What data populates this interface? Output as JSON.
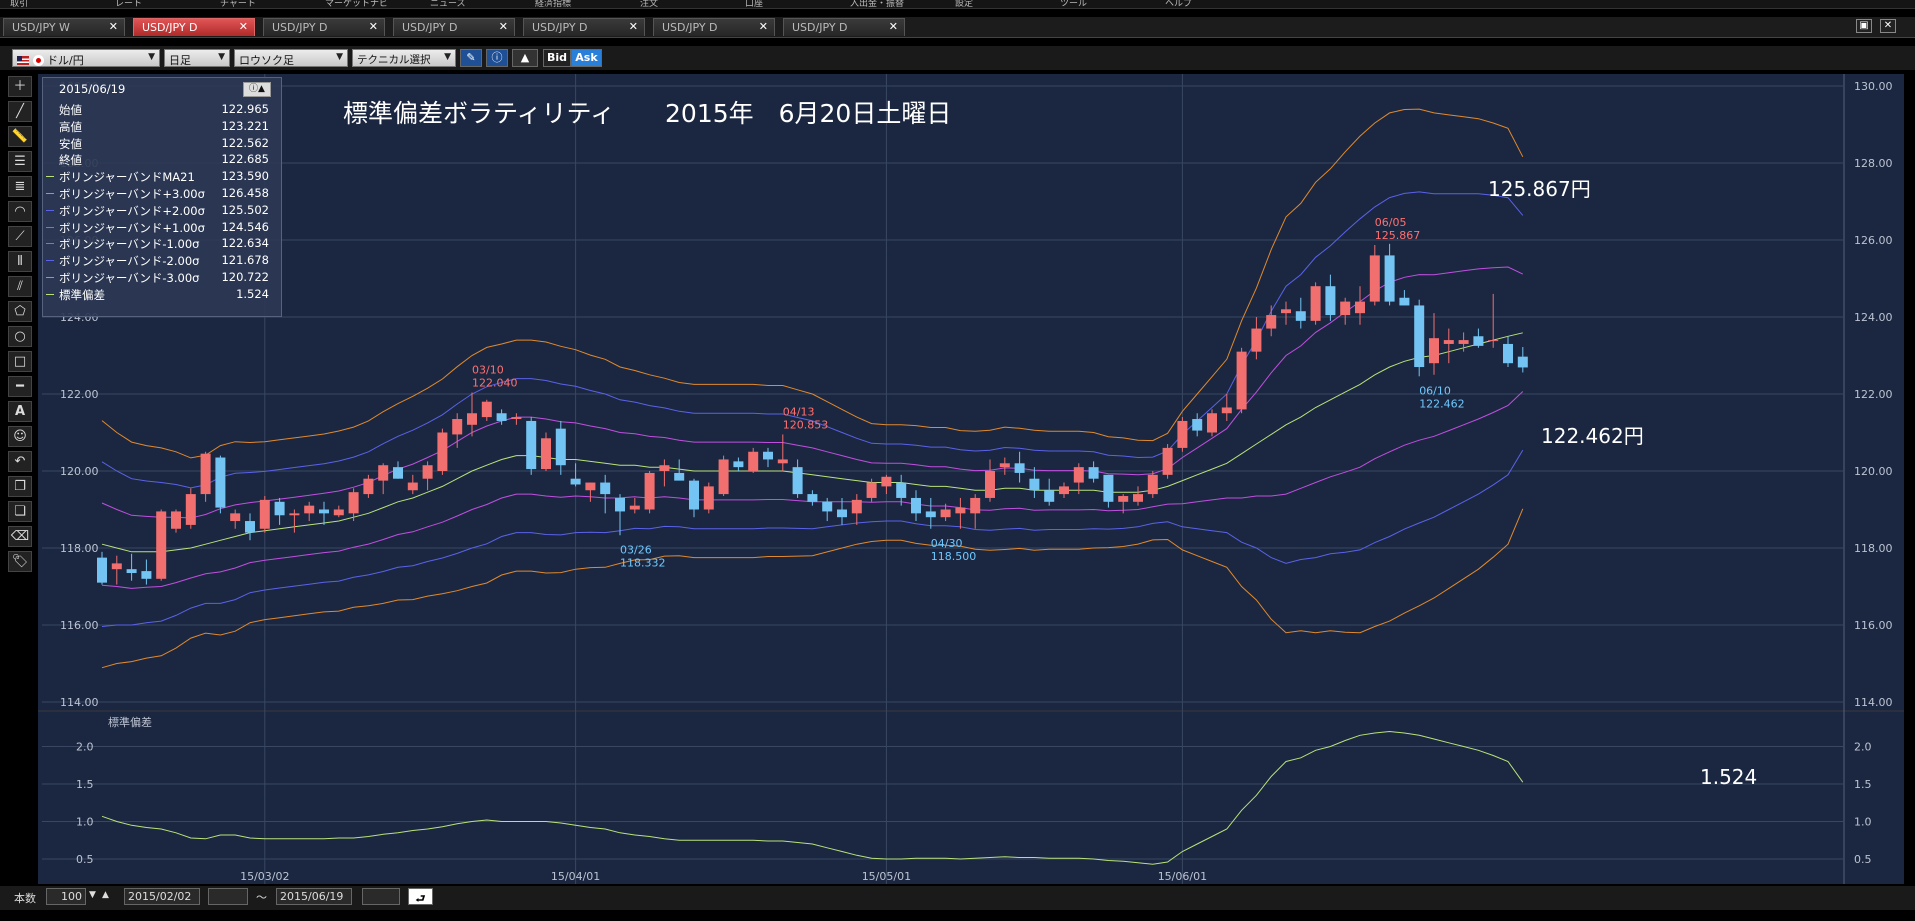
{
  "menu": [
    "取引",
    "レート",
    "チャート",
    "マーケットナビ",
    "ニュース",
    "経済指標",
    "注文",
    "口座",
    "入出金・振替",
    "設定",
    "ツール",
    "ヘルプ"
  ],
  "tabs": [
    {
      "label": "USD/JPY W",
      "active": false
    },
    {
      "label": "USD/JPY D",
      "active": true
    },
    {
      "label": "USD/JPY D",
      "active": false
    },
    {
      "label": "USD/JPY D",
      "active": false
    },
    {
      "label": "USD/JPY D",
      "active": false
    },
    {
      "label": "USD/JPY D",
      "active": false
    },
    {
      "label": "USD/JPY D",
      "active": false
    }
  ],
  "toolbar": {
    "pair": "ドル/円",
    "timeframe": "日足",
    "chart_type": "ロウソク足",
    "technical": "テクニカル選択",
    "bid": "Bid",
    "ask": "Ask"
  },
  "info": {
    "date": "2015/06/19",
    "rows": [
      {
        "label": "始値",
        "value": "122.965",
        "color": ""
      },
      {
        "label": "高値",
        "value": "123.221",
        "color": ""
      },
      {
        "label": "安値",
        "value": "122.562",
        "color": ""
      },
      {
        "label": "終値",
        "value": "122.685",
        "color": ""
      },
      {
        "label": "ボリンジャーバンドMA21",
        "value": "123.590",
        "color": "#b9e27a"
      },
      {
        "label": "ボリンジャーバンド+3.00σ",
        "value": "126.458",
        "color": "#e0892d"
      },
      {
        "label": "ボリンジャーバンド+2.00σ",
        "value": "125.502",
        "color": "#5a62e8"
      },
      {
        "label": "ボリンジャーバンド+1.00σ",
        "value": "124.546",
        "color": "#c04fe0"
      },
      {
        "label": "ボリンジャーバンド-1.00σ",
        "value": "122.634",
        "color": "#c04fe0"
      },
      {
        "label": "ボリンジャーバンド-2.00σ",
        "value": "121.678",
        "color": "#5a62e8"
      },
      {
        "label": "ボリンジャーバンド-3.00σ",
        "value": "120.722",
        "color": "#e0892d"
      },
      {
        "label": "標準偏差",
        "value": "1.524",
        "color": "#b9e27a"
      }
    ]
  },
  "chart_data": {
    "type": "candlestick",
    "title": "標準偏差ボラティリティ　　2015年　6月20日土曜日",
    "ylim": [
      114,
      130
    ],
    "yticks": [
      "114.00",
      "116.00",
      "118.00",
      "120.00",
      "122.00",
      "124.00",
      "126.00",
      "128.00",
      "130.00"
    ],
    "xticks": [
      {
        "label": "15/03/02",
        "i": 11
      },
      {
        "label": "15/04/01",
        "i": 32
      },
      {
        "label": "15/05/01",
        "i": 53
      },
      {
        "label": "15/06/01",
        "i": 73
      }
    ],
    "candles": [
      [
        117.75,
        117.9,
        117.05,
        117.1
      ],
      [
        117.45,
        117.8,
        117.05,
        117.6
      ],
      [
        117.45,
        117.85,
        117.15,
        117.35
      ],
      [
        117.4,
        117.7,
        117.05,
        117.2
      ],
      [
        117.2,
        119.0,
        117.15,
        118.95
      ],
      [
        118.5,
        119.0,
        118.4,
        118.95
      ],
      [
        118.6,
        119.55,
        118.5,
        119.4
      ],
      [
        119.4,
        120.5,
        119.2,
        120.45
      ],
      [
        120.35,
        120.4,
        118.9,
        119.05
      ],
      [
        118.7,
        119.0,
        118.5,
        118.9
      ],
      [
        118.7,
        118.9,
        118.2,
        118.4
      ],
      [
        118.5,
        119.35,
        118.4,
        119.25
      ],
      [
        119.2,
        119.3,
        118.6,
        118.85
      ],
      [
        118.85,
        119.0,
        118.4,
        118.9
      ],
      [
        118.9,
        119.2,
        118.7,
        119.1
      ],
      [
        119.0,
        119.2,
        118.6,
        118.9
      ],
      [
        118.85,
        119.1,
        118.8,
        119.0
      ],
      [
        118.9,
        119.55,
        118.7,
        119.45
      ],
      [
        119.4,
        119.9,
        119.3,
        119.8
      ],
      [
        119.75,
        120.2,
        119.4,
        120.15
      ],
      [
        120.1,
        120.25,
        119.8,
        119.8
      ],
      [
        119.5,
        119.9,
        119.4,
        119.7
      ],
      [
        119.8,
        120.25,
        119.5,
        120.15
      ],
      [
        120.0,
        121.1,
        119.9,
        121.0
      ],
      [
        120.95,
        121.5,
        120.6,
        121.35
      ],
      [
        121.2,
        122.04,
        120.9,
        121.5
      ],
      [
        121.4,
        121.85,
        121.3,
        121.8
      ],
      [
        121.5,
        121.6,
        121.2,
        121.3
      ],
      [
        121.35,
        121.5,
        121.2,
        121.4
      ],
      [
        121.3,
        121.4,
        119.9,
        120.05
      ],
      [
        120.05,
        121.0,
        120.0,
        120.85
      ],
      [
        121.1,
        121.3,
        119.9,
        120.15
      ],
      [
        119.8,
        120.2,
        119.6,
        119.65
      ],
      [
        119.5,
        119.7,
        119.2,
        119.7
      ],
      [
        119.7,
        119.9,
        118.9,
        119.4
      ],
      [
        119.3,
        119.4,
        118.33,
        118.95
      ],
      [
        119.0,
        119.3,
        118.9,
        119.1
      ],
      [
        119.0,
        120.0,
        118.9,
        119.95
      ],
      [
        120.0,
        120.3,
        119.6,
        120.15
      ],
      [
        119.95,
        120.3,
        119.8,
        119.75
      ],
      [
        119.75,
        119.8,
        118.8,
        119.0
      ],
      [
        119.0,
        119.7,
        118.9,
        119.6
      ],
      [
        119.4,
        120.4,
        119.35,
        120.3
      ],
      [
        120.25,
        120.35,
        120.0,
        120.1
      ],
      [
        120.0,
        120.6,
        119.95,
        120.5
      ],
      [
        120.5,
        120.6,
        120.1,
        120.3
      ],
      [
        120.2,
        120.95,
        120.0,
        120.3
      ],
      [
        120.1,
        120.3,
        119.3,
        119.4
      ],
      [
        119.4,
        119.5,
        119.1,
        119.2
      ],
      [
        119.2,
        119.3,
        118.7,
        118.95
      ],
      [
        119.0,
        119.3,
        118.6,
        118.8
      ],
      [
        118.9,
        119.4,
        118.6,
        119.25
      ],
      [
        119.3,
        119.8,
        119.2,
        119.7
      ],
      [
        119.6,
        119.9,
        119.4,
        119.85
      ],
      [
        119.7,
        119.9,
        119.1,
        119.3
      ],
      [
        119.3,
        119.5,
        118.7,
        118.9
      ],
      [
        118.95,
        119.3,
        118.5,
        118.8
      ],
      [
        118.8,
        119.15,
        118.7,
        119.0
      ],
      [
        118.9,
        119.3,
        118.5,
        119.05
      ],
      [
        118.9,
        119.4,
        118.5,
        119.3
      ],
      [
        119.3,
        120.3,
        119.2,
        120.0
      ],
      [
        120.1,
        120.35,
        119.9,
        120.2
      ],
      [
        120.2,
        120.5,
        119.7,
        119.95
      ],
      [
        119.8,
        120.1,
        119.3,
        119.5
      ],
      [
        119.5,
        119.8,
        119.1,
        119.2
      ],
      [
        119.4,
        119.7,
        119.3,
        119.6
      ],
      [
        119.7,
        120.2,
        119.4,
        120.1
      ],
      [
        120.1,
        120.25,
        119.7,
        119.8
      ],
      [
        119.9,
        119.9,
        119.05,
        119.2
      ],
      [
        119.2,
        119.4,
        118.9,
        119.35
      ],
      [
        119.2,
        119.6,
        119.1,
        119.4
      ],
      [
        119.4,
        120.0,
        119.3,
        119.9
      ],
      [
        119.9,
        120.7,
        119.8,
        120.6
      ],
      [
        120.6,
        121.4,
        120.5,
        121.3
      ],
      [
        121.35,
        121.5,
        120.9,
        121.05
      ],
      [
        121.0,
        121.6,
        120.9,
        121.5
      ],
      [
        121.5,
        122.0,
        121.3,
        121.65
      ],
      [
        121.6,
        123.2,
        121.5,
        123.1
      ],
      [
        123.1,
        124.0,
        122.9,
        123.7
      ],
      [
        123.7,
        124.3,
        123.5,
        124.05
      ],
      [
        124.1,
        124.4,
        123.8,
        124.2
      ],
      [
        124.15,
        124.5,
        123.7,
        123.9
      ],
      [
        123.9,
        124.9,
        123.8,
        124.8
      ],
      [
        124.8,
        125.1,
        123.9,
        124.05
      ],
      [
        124.05,
        124.5,
        123.8,
        124.4
      ],
      [
        124.1,
        124.8,
        123.8,
        124.4
      ],
      [
        124.4,
        125.87,
        124.3,
        125.6
      ],
      [
        125.6,
        125.9,
        124.3,
        124.4
      ],
      [
        124.5,
        124.7,
        124.3,
        124.3
      ],
      [
        124.3,
        124.45,
        122.46,
        122.7
      ],
      [
        122.8,
        124.1,
        122.5,
        123.45
      ],
      [
        123.3,
        123.7,
        122.8,
        123.4
      ],
      [
        123.3,
        123.6,
        123.1,
        123.4
      ],
      [
        123.5,
        123.7,
        123.2,
        123.25
      ],
      [
        123.4,
        124.6,
        123.2,
        123.4
      ],
      [
        123.3,
        123.5,
        122.7,
        122.8
      ],
      [
        122.97,
        123.22,
        122.56,
        122.69
      ]
    ],
    "bands": {
      "ma21": [
        118.1,
        118.0,
        117.9,
        117.9,
        117.9,
        117.95,
        118.0,
        118.1,
        118.2,
        118.3,
        118.4,
        118.45,
        118.5,
        118.55,
        118.6,
        118.65,
        118.7,
        118.8,
        118.9,
        119.05,
        119.2,
        119.3,
        119.45,
        119.6,
        119.8,
        120.0,
        120.15,
        120.3,
        120.4,
        120.4,
        120.35,
        120.3,
        120.3,
        120.25,
        120.2,
        120.15,
        120.15,
        120.1,
        120.1,
        120.05,
        120.0,
        120.0,
        120.0,
        120.0,
        120.0,
        120.0,
        120.0,
        119.95,
        119.9,
        119.85,
        119.8,
        119.75,
        119.7,
        119.7,
        119.7,
        119.65,
        119.6,
        119.6,
        119.55,
        119.5,
        119.5,
        119.55,
        119.55,
        119.5,
        119.5,
        119.5,
        119.5,
        119.5,
        119.45,
        119.45,
        119.45,
        119.5,
        119.6,
        119.75,
        119.9,
        120.05,
        120.2,
        120.45,
        120.7,
        120.95,
        121.2,
        121.4,
        121.65,
        121.85,
        122.05,
        122.25,
        122.5,
        122.7,
        122.85,
        122.95,
        123.0,
        123.1,
        123.2,
        123.3,
        123.4,
        123.5,
        123.59
      ],
      "sd": [
        1.07,
        1.0,
        0.95,
        0.92,
        0.9,
        0.85,
        0.78,
        0.77,
        0.82,
        0.82,
        0.78,
        0.77,
        0.77,
        0.77,
        0.77,
        0.77,
        0.78,
        0.78,
        0.8,
        0.83,
        0.85,
        0.88,
        0.9,
        0.93,
        0.97,
        1.0,
        1.02,
        1.0,
        1.0,
        1.0,
        1.0,
        0.98,
        0.95,
        0.92,
        0.9,
        0.85,
        0.82,
        0.8,
        0.77,
        0.75,
        0.75,
        0.75,
        0.75,
        0.75,
        0.75,
        0.74,
        0.74,
        0.72,
        0.7,
        0.65,
        0.6,
        0.55,
        0.51,
        0.5,
        0.5,
        0.51,
        0.51,
        0.51,
        0.5,
        0.51,
        0.52,
        0.53,
        0.52,
        0.52,
        0.51,
        0.51,
        0.51,
        0.5,
        0.48,
        0.47,
        0.45,
        0.43,
        0.46,
        0.6,
        0.7,
        0.8,
        0.9,
        1.15,
        1.35,
        1.6,
        1.8,
        1.85,
        1.95,
        2.0,
        2.08,
        2.15,
        2.18,
        2.2,
        2.18,
        2.15,
        2.1,
        2.05,
        2.0,
        1.95,
        1.88,
        1.8,
        1.524
      ]
    },
    "labels": [
      {
        "i": 25,
        "text1": "03/10",
        "text2": "122.040",
        "pos": "above",
        "color": "#ff7070"
      },
      {
        "i": 35,
        "text1": "03/26",
        "text2": "118.332",
        "pos": "below",
        "color": "#6ec8ff"
      },
      {
        "i": 46,
        "text1": "04/13",
        "text2": "120.853",
        "pos": "above",
        "color": "#ff7070"
      },
      {
        "i": 56,
        "text1": "04/30",
        "text2": "118.500",
        "pos": "below",
        "color": "#6ec8ff"
      },
      {
        "i": 86,
        "text1": "06/05",
        "text2": "125.867",
        "pos": "above",
        "color": "#ff7070"
      },
      {
        "i": 89,
        "text1": "06/10",
        "text2": "122.462",
        "pos": "below",
        "color": "#6ec8ff"
      }
    ],
    "annotations": {
      "high": "125.867円",
      "low": "122.462円",
      "sd": "1.524"
    },
    "sub": {
      "title": "標準偏差",
      "ylim": [
        0.3,
        2.3
      ],
      "yticks": [
        "0.5",
        "1.0",
        "1.5",
        "2.0"
      ]
    }
  },
  "bottom": {
    "count_label": "本数",
    "count": "100",
    "from": "2015/02/02",
    "tilde": "〜",
    "to": "2015/06/19"
  }
}
